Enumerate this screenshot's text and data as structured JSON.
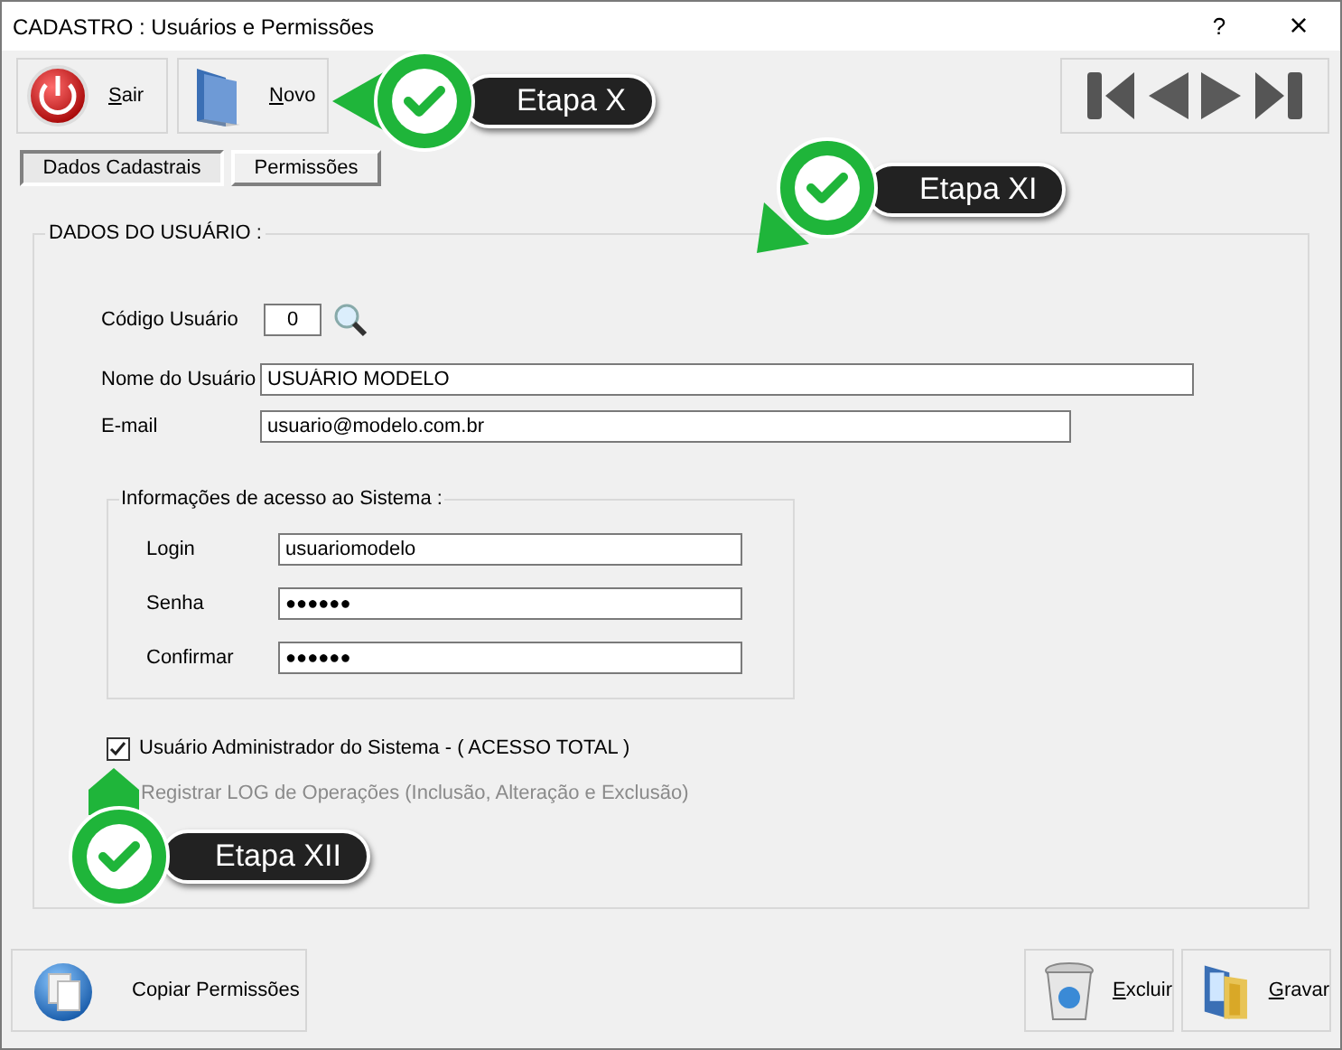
{
  "window": {
    "title": "CADASTRO : Usuários e Permissões",
    "help": "?",
    "close": "×"
  },
  "toolbar": [
    {
      "label": "Sair",
      "kind": "exit"
    },
    {
      "label": "Novo",
      "kind": "new"
    }
  ],
  "tabs": [
    {
      "label": "Dados Cadastrais",
      "selected": true
    },
    {
      "label": "Permissões",
      "selected": false
    }
  ],
  "user_group": {
    "title": "DADOS DO USUÁRIO :",
    "fields": [
      {
        "label": "Código Usuário",
        "value": "0",
        "kind": "code"
      },
      {
        "label": "Nome do Usuário",
        "value": "USUÁRIO MODELO",
        "kind": "name"
      },
      {
        "label": "E-mail",
        "value": "usuario@modelo.com.br",
        "kind": "email"
      }
    ]
  },
  "access_group": {
    "title": "Informações de acesso ao Sistema :",
    "fields": [
      {
        "label": "Login",
        "value": "usuariomodelo",
        "kind": "text"
      },
      {
        "label": "Senha",
        "value": "●●●●●●",
        "kind": "password"
      },
      {
        "label": "Confirmar",
        "value": "●●●●●●",
        "kind": "password"
      }
    ]
  },
  "options": [
    {
      "label": "Usuário Administrador do Sistema - ( ACESSO TOTAL )",
      "checked": true,
      "disabled": false
    },
    {
      "label": "Registrar LOG de Operações (Inclusão, Alteração e Exclusão)",
      "disabled": true
    }
  ],
  "bottom_buttons": [
    {
      "label": "Copiar Permissões",
      "kind": "copy"
    },
    {
      "label": "Excluir",
      "kind": "delete"
    },
    {
      "label": "Gravar",
      "kind": "save"
    }
  ],
  "callouts": [
    {
      "label": "Etapa X",
      "kind": "left"
    },
    {
      "label": "Etapa XI",
      "kind": "down-left"
    },
    {
      "label": "Etapa XII",
      "kind": "up"
    }
  ]
}
